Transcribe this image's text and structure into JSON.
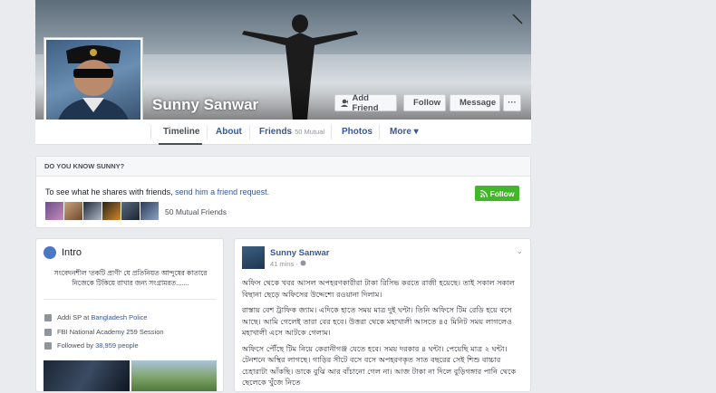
{
  "profile": {
    "name": "Sunny Sanwar"
  },
  "header": {
    "add_friend": "Add Friend",
    "follow": "Follow",
    "message": "Message",
    "more_dots": "···"
  },
  "nav": {
    "tabs": [
      {
        "label": "Timeline"
      },
      {
        "label": "About"
      },
      {
        "label": "Friends",
        "badge": "50 Mutual"
      },
      {
        "label": "Photos"
      },
      {
        "label": "More ▾"
      }
    ]
  },
  "know": {
    "title": "DO YOU KNOW SUNNY?",
    "text": "To see what he shares with friends,",
    "link": "send him a friend request.",
    "follow_label": "Follow",
    "mutual_count": "50 Mutual Friends"
  },
  "intro": {
    "title": "Intro",
    "bio": "সংবেদনশীল 'তকটি প্রাণী' যে প্রতিনিয়ত আন্দুষের কাতারে নিজেকে টিকিয়ে রাখার জন্য সংগ্রামরত.......",
    "rows": [
      {
        "prefix": "Addi SP at",
        "link": "Bangladesh Police"
      },
      {
        "prefix": "FBI National Academy 259 Session",
        "link": ""
      },
      {
        "prefix": "Followed by",
        "link": "38,959 people"
      }
    ]
  },
  "post": {
    "author": "Sunny Sanwar",
    "time": "41 mins · ",
    "paragraphs": [
      "অফিস থেকে খবর আসল অপহরণকারীরা টাকা রিসিভ করতে রাজী হয়েছে। তাই সকাল সকাল বিছানা ছেড়ে অফিসের উদ্দেশ্যে রওয়ানা দিলাম।",
      "রাস্তায় বেশ ট্রাফিক জ্যাম। এদিকে হাতে সময় মাত্র দুই ঘন্টা। তিনি অফিসে টিম রেডি হয়ে বসে আছে। আমি গেলেই তারা বের হবে। উত্তরা থেকে মহাখালী আসতে ৪৫ মিনিট সময় লাগলেও মহাখালী এসে আটকে গেলাম।",
      "অফিসে পৌঁছে টিম নিয়ে কেরানীগঞ্জ যেতে হবে। সময় দরকার ৪ ঘন্টা। পেয়েছি মাত্র ২ ঘন্টা। টেনশনে অস্থির লাগছে। গাড়ির সীটে বসে বসে অপহরণকৃত সাত বছরের সেই শিশু বাচ্চার চেহারাটা আঁকছি। ডাকে বুঝি আর বাঁচানো গেল না। আজ টাকা না দিলে বুড়িগঙ্গার পানি থেকে ছেলেকে খুঁজে নিতে"
    ]
  }
}
